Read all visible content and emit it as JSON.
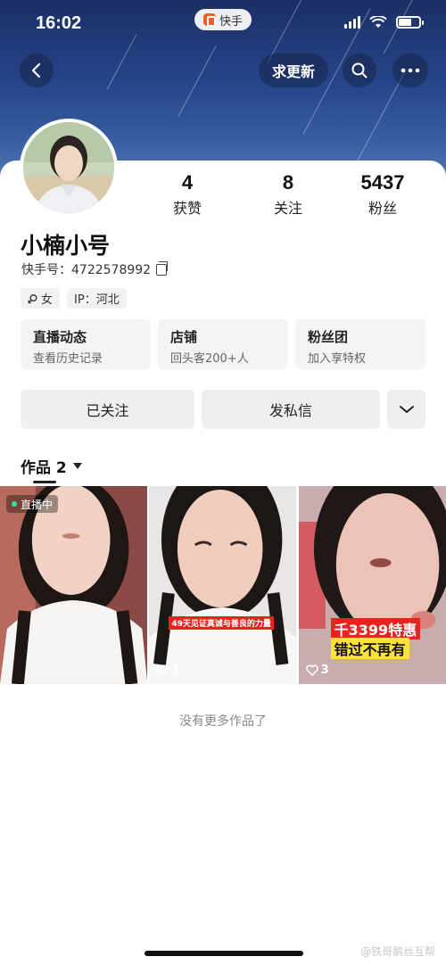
{
  "status_bar": {
    "time": "16:02",
    "app_name": "快手"
  },
  "nav": {
    "update_label": "求更新"
  },
  "profile": {
    "stats": [
      {
        "value": "4",
        "label": "获赞"
      },
      {
        "value": "8",
        "label": "关注"
      },
      {
        "value": "5437",
        "label": "粉丝"
      }
    ],
    "name": "小楠小号",
    "uid": "快手号：4722578992",
    "tags": {
      "gender": "女",
      "ip": "IP：河北"
    }
  },
  "features": [
    {
      "title": "直播动态",
      "subtitle": "查看历史记录"
    },
    {
      "title": "店铺",
      "subtitle": "回头客200+人"
    },
    {
      "title": "粉丝团",
      "subtitle": "加入享特权"
    }
  ],
  "actions": {
    "follow_label": "已关注",
    "message_label": "发私信"
  },
  "works": {
    "tab_label": "作品 2",
    "items": [
      {
        "badge": "直播中"
      },
      {
        "caption": "49天见证真诚与善良的力量",
        "likes": "1"
      },
      {
        "caption_line1": "千3399特惠",
        "caption_line2": "错过不再有",
        "likes": "3"
      }
    ],
    "end_text": "没有更多作品了"
  },
  "watermark": "@铁哥鹅丝互帮"
}
